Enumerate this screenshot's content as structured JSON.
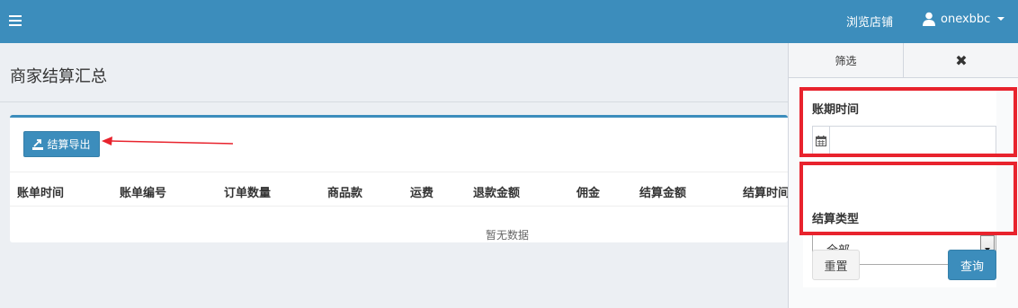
{
  "topbar": {
    "menu_icon": "hamburger-icon",
    "browse_store": "浏览店铺",
    "username": "onexbbc",
    "user_icon": "user-icon",
    "bg_color": "#3c8dbc"
  },
  "header": {
    "title": "商家结算汇总"
  },
  "toolbar": {
    "export_label": "结算导出",
    "export_icon": "export-icon"
  },
  "table": {
    "columns": [
      "账单时间",
      "账单编号",
      "订单数量",
      "商品款",
      "运费",
      "退款金额",
      "佣金",
      "结算金额",
      "结算时间"
    ],
    "empty_text": "暂无数据"
  },
  "filter_panel": {
    "tab_filter": "筛选",
    "tab_close": "✖",
    "period_label": "账期时间",
    "period_value": "",
    "calendar_icon": "calendar-icon",
    "type_label": "结算类型",
    "type_selected": "全部",
    "reset_label": "重置",
    "query_label": "查询",
    "highlight_color": "#e8232d"
  }
}
